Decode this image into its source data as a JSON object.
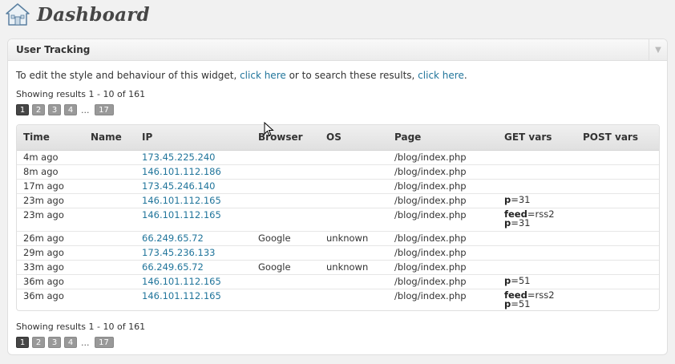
{
  "header": {
    "title": "Dashboard"
  },
  "widget": {
    "title": "User Tracking",
    "intro": {
      "part1": "To edit the style and behaviour of this widget, ",
      "link1": "click here",
      "part2": " or to search these results, ",
      "link2": "click here",
      "part3": "."
    },
    "results_text": "Showing results 1 - 10 of 161",
    "pages": [
      "1",
      "2",
      "3",
      "4"
    ],
    "ellipsis": "...",
    "last_page": "17"
  },
  "table": {
    "columns": [
      "Time",
      "Name",
      "IP",
      "Browser",
      "OS",
      "Page",
      "GET vars",
      "POST vars"
    ],
    "rows": [
      {
        "time": "4m ago",
        "name": "",
        "ip": "173.45.225.240",
        "browser": "",
        "os": "",
        "page": "/blog/index.php",
        "get": [],
        "post": ""
      },
      {
        "time": "8m ago",
        "name": "",
        "ip": "146.101.112.186",
        "browser": "",
        "os": "",
        "page": "/blog/index.php",
        "get": [],
        "post": ""
      },
      {
        "time": "17m ago",
        "name": "",
        "ip": "173.45.246.140",
        "browser": "",
        "os": "",
        "page": "/blog/index.php",
        "get": [],
        "post": ""
      },
      {
        "time": "23m ago",
        "name": "",
        "ip": "146.101.112.165",
        "browser": "",
        "os": "",
        "page": "/blog/index.php",
        "get": [
          {
            "k": "p",
            "v": "=31"
          }
        ],
        "post": ""
      },
      {
        "time": "23m ago",
        "name": "",
        "ip": "146.101.112.165",
        "browser": "",
        "os": "",
        "page": "/blog/index.php",
        "get": [
          {
            "k": "feed",
            "v": "=rss2"
          },
          {
            "k": "p",
            "v": "=31"
          }
        ],
        "post": ""
      },
      {
        "time": "26m ago",
        "name": "",
        "ip": "66.249.65.72",
        "browser": "Google",
        "os": "unknown",
        "page": "/blog/index.php",
        "get": [],
        "post": ""
      },
      {
        "time": "29m ago",
        "name": "",
        "ip": "173.45.236.133",
        "browser": "",
        "os": "",
        "page": "/blog/index.php",
        "get": [],
        "post": ""
      },
      {
        "time": "33m ago",
        "name": "",
        "ip": "66.249.65.72",
        "browser": "Google",
        "os": "unknown",
        "page": "/blog/index.php",
        "get": [],
        "post": ""
      },
      {
        "time": "36m ago",
        "name": "",
        "ip": "146.101.112.165",
        "browser": "",
        "os": "",
        "page": "/blog/index.php",
        "get": [
          {
            "k": "p",
            "v": "=51"
          }
        ],
        "post": ""
      },
      {
        "time": "36m ago",
        "name": "",
        "ip": "146.101.112.165",
        "browser": "",
        "os": "",
        "page": "/blog/index.php",
        "get": [
          {
            "k": "feed",
            "v": "=rss2"
          },
          {
            "k": "p",
            "v": "=51"
          }
        ],
        "post": ""
      }
    ]
  },
  "colors": {
    "link": "#21759b",
    "page_current": "#464646",
    "page_other": "#999999"
  },
  "icons": {
    "header": "home-icon",
    "widget_toggle": "arrow-down-icon",
    "pointer": "mouse-cursor-icon"
  }
}
